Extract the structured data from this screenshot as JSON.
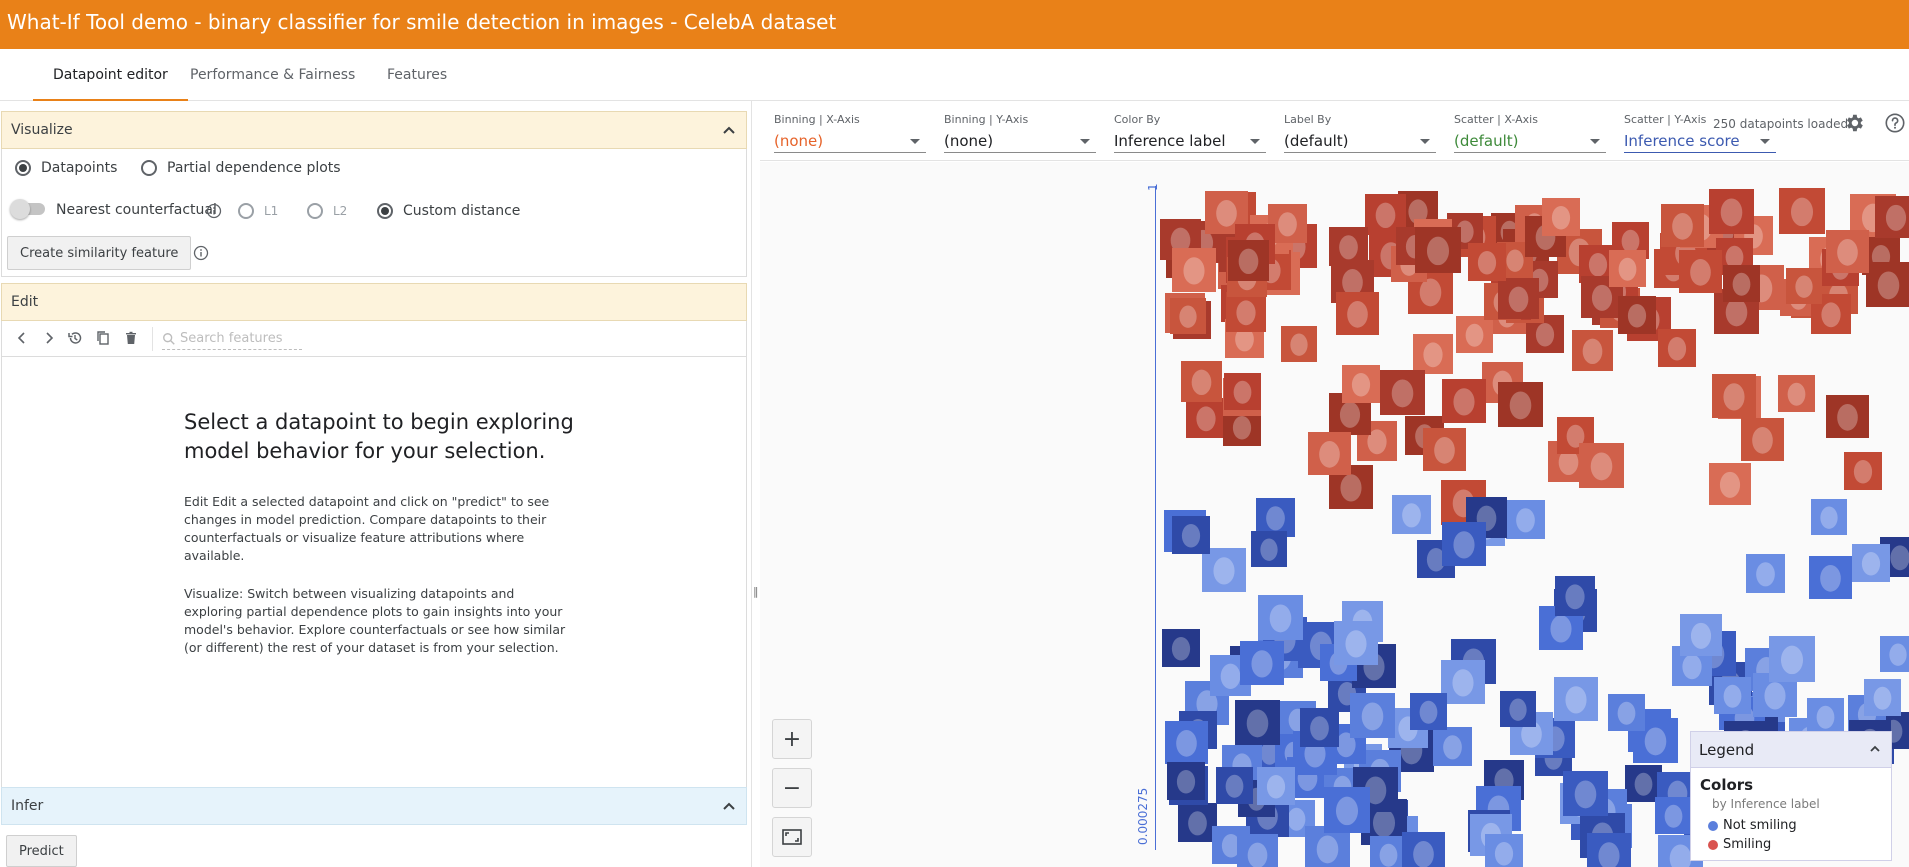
{
  "app": {
    "title": "What-If Tool demo - binary classifier for smile detection in images - CelebA dataset"
  },
  "tabs": [
    {
      "label": "Datapoint editor",
      "active": true
    },
    {
      "label": "Performance & Fairness",
      "active": false
    },
    {
      "label": "Features",
      "active": false
    }
  ],
  "header": {
    "datapoints_loaded": "250 datapoints loaded",
    "settings_icon": "gear-icon",
    "help_icon": "help-icon"
  },
  "visualize": {
    "title": "Visualize",
    "mode_options": [
      "Datapoints",
      "Partial dependence plots"
    ],
    "selected_mode": "Datapoints",
    "counterfactual": {
      "label": "Nearest counterfactual",
      "enabled": false,
      "distance_options": [
        "L1",
        "L2",
        "Custom distance"
      ],
      "selected_distance": "Custom distance"
    },
    "similarity_button": "Create similarity feature"
  },
  "edit": {
    "title": "Edit",
    "search_placeholder": "Search features",
    "empty_heading": "Select a datapoint to begin exploring model behavior for your selection.",
    "paragraph_edit": "Edit Edit a selected datapoint and click on \"predict\" to see changes in model prediction. Compare datapoints to their counterfactuals or visualize feature attributions where available.",
    "paragraph_visualize": "Visualize: Switch between visualizing datapoints and exploring partial dependence plots to gain insights into your model's behavior. Explore counterfactuals or see how similar (or different) the rest of your dataset is from your selection."
  },
  "infer": {
    "title": "Infer",
    "predict_button": "Predict"
  },
  "controls": [
    {
      "label": "Binning | X-Axis",
      "value": "(none)",
      "tone": "orange"
    },
    {
      "label": "Binning | Y-Axis",
      "value": "(none)",
      "tone": "default"
    },
    {
      "label": "Color By",
      "value": "Inference label",
      "tone": "default"
    },
    {
      "label": "Label By",
      "value": "(default)",
      "tone": "default"
    },
    {
      "label": "Scatter | X-Axis",
      "value": "(default)",
      "tone": "green"
    },
    {
      "label": "Scatter | Y-Axis",
      "value": "Inference score",
      "tone": "blue"
    }
  ],
  "plot": {
    "y_axis_top_label": "1",
    "y_axis_bottom_label": "0.000275",
    "zoom_in_label": "+",
    "zoom_out_label": "−"
  },
  "legend": {
    "title": "Legend",
    "section": "Colors",
    "subtitle": "by Inference label",
    "items": [
      {
        "label": "Not smiling",
        "color": "#5b7fdc"
      },
      {
        "label": "Smiling",
        "color": "#d9534f"
      }
    ]
  },
  "colors": {
    "accent": "#e98118",
    "smiling": "#c8553d",
    "not_smiling": "#4a6fd6"
  }
}
